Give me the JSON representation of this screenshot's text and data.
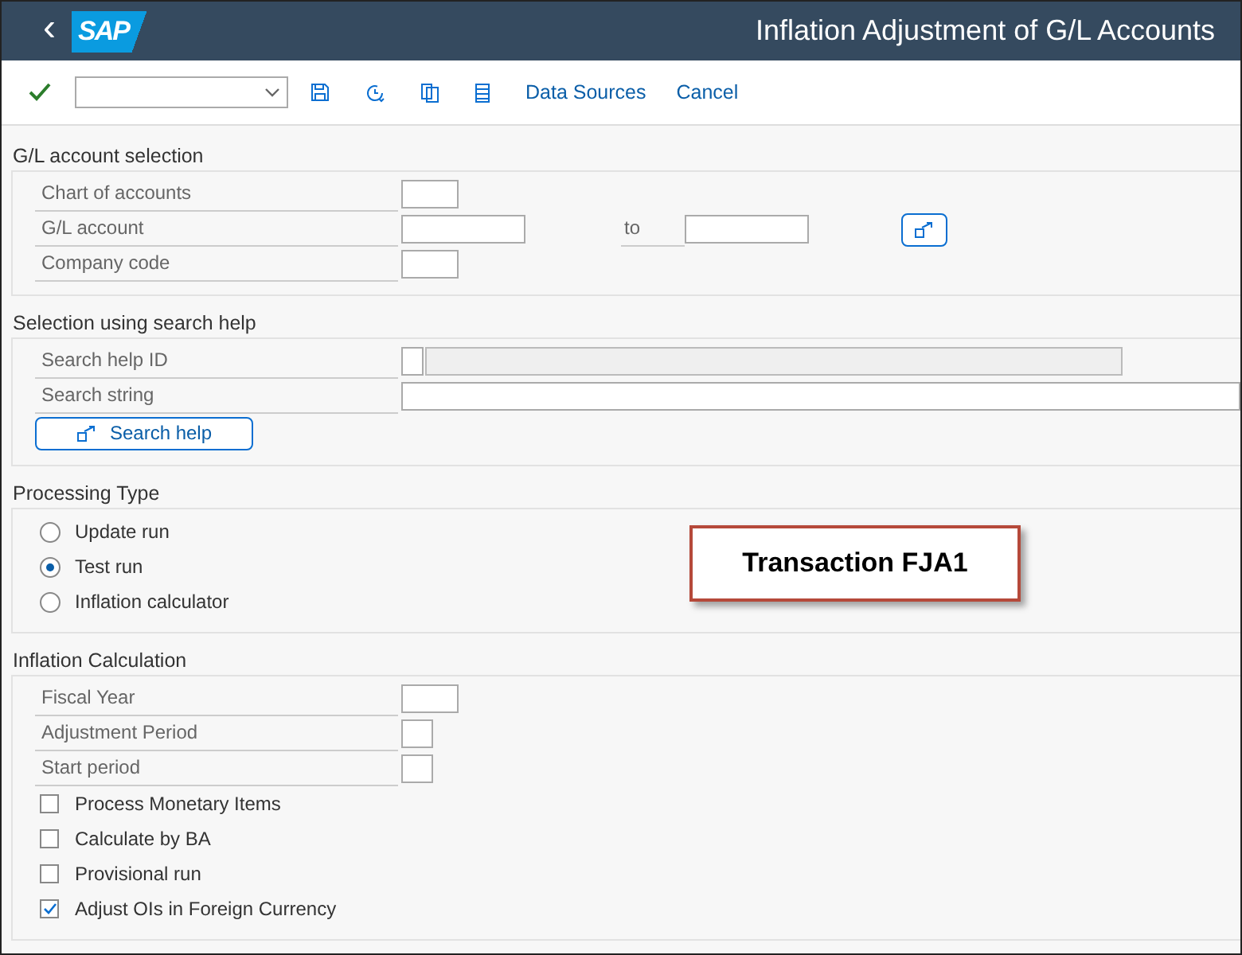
{
  "header": {
    "back": "‹",
    "logo": "SAP",
    "title": "Inflation Adjustment of G/L Accounts"
  },
  "toolbar": {
    "links": [
      "Data Sources",
      "Cancel"
    ]
  },
  "sections": [
    {
      "title": "G/L account selection",
      "items": [
        {
          "kind": "short-field",
          "label": "Chart of accounts"
        },
        {
          "kind": "range",
          "label": "G/L account",
          "to_label": "to"
        },
        {
          "kind": "short-field",
          "label": "Company code"
        }
      ]
    },
    {
      "title": "Selection using search help",
      "items": [
        {
          "kind": "id-field",
          "label": "Search help ID"
        },
        {
          "kind": "wide-field",
          "label": "Search string"
        },
        {
          "kind": "button",
          "label": "Search help"
        }
      ]
    },
    {
      "title": "Processing Type",
      "items": [
        {
          "kind": "radio",
          "label": "Update run",
          "selected": false
        },
        {
          "kind": "radio",
          "label": "Test run",
          "selected": true
        },
        {
          "kind": "radio",
          "label": "Inflation calculator",
          "selected": false
        }
      ]
    },
    {
      "title": "Inflation Calculation",
      "items": [
        {
          "kind": "short-field",
          "label": "Fiscal Year"
        },
        {
          "kind": "tiny-field",
          "label": "Adjustment Period"
        },
        {
          "kind": "tiny-field",
          "label": "Start period"
        },
        {
          "kind": "checkbox",
          "label": "Process Monetary Items",
          "checked": false
        },
        {
          "kind": "checkbox",
          "label": "Calculate by BA",
          "checked": false
        },
        {
          "kind": "checkbox",
          "label": "Provisional run",
          "checked": false
        },
        {
          "kind": "checkbox",
          "label": "Adjust OIs in Foreign Currency",
          "checked": true
        }
      ]
    }
  ],
  "callout": {
    "text": "Transaction FJA1"
  }
}
